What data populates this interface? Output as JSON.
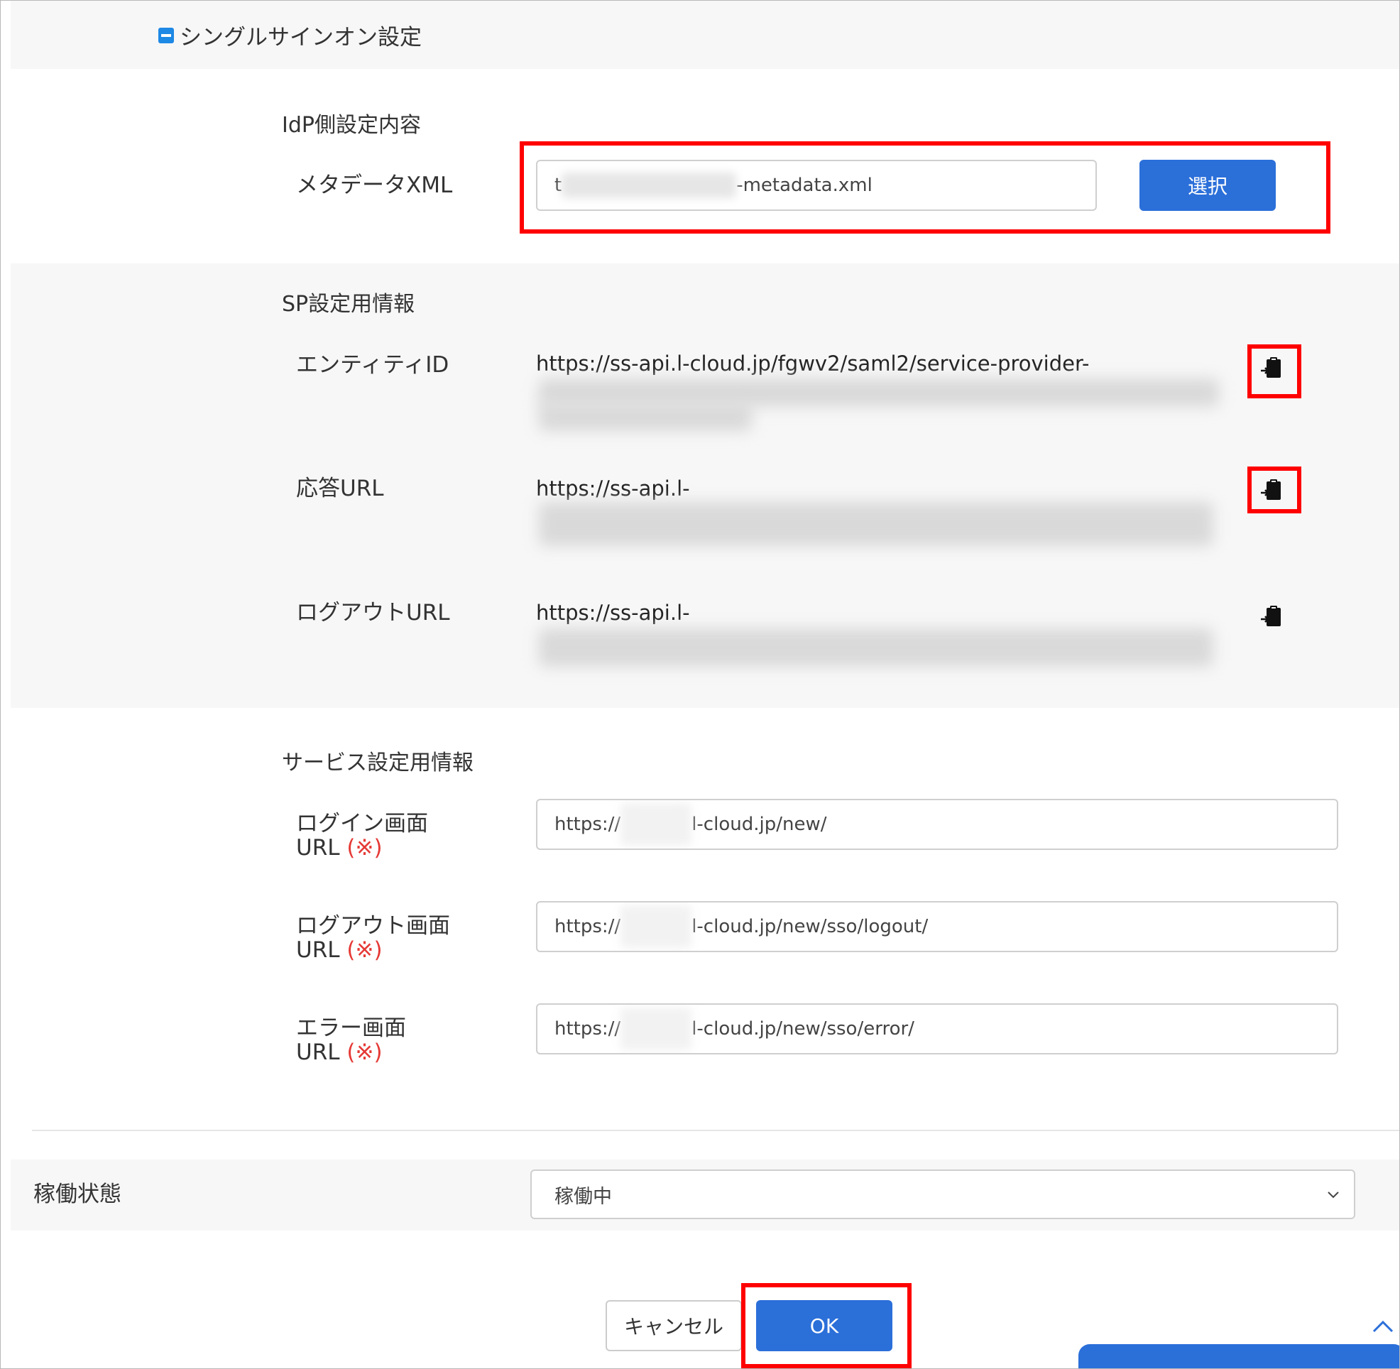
{
  "section": {
    "title": "シングルサインオン設定"
  },
  "idp": {
    "title": "IdP側設定内容",
    "metadata_label": "メタデータXML",
    "metadata_file_prefix": "t",
    "metadata_file_suffix": "-metadata.xml",
    "select_button": "選択"
  },
  "sp": {
    "title": "SP設定用情報",
    "entity_id_label": "エンティティID",
    "entity_id_value": "https://ss-api.l-cloud.jp/fgwv2/saml2/service-provider-",
    "reply_url_label": "応答URL",
    "reply_url_value": "https://ss-api.l-",
    "logout_url_label": "ログアウトURL",
    "logout_url_value": "https://ss-api.l-",
    "copy_icon": "clipboard-copy-icon"
  },
  "service": {
    "title": "サービス設定用情報",
    "login_label_line1": "ログイン画面",
    "logout_label_line1": "ログアウト画面",
    "error_label_line1": "エラー画面",
    "url_label": "URL",
    "required_mark": "(※)",
    "url_prefix": "https://",
    "login_url_suffix": "l-cloud.jp/new/",
    "logout_url_suffix": "l-cloud.jp/new/sso/logout/",
    "error_url_suffix": "l-cloud.jp/new/sso/error/"
  },
  "status": {
    "label": "稼働状態",
    "selected": "稼働中"
  },
  "footer": {
    "cancel": "キャンセル",
    "ok": "OK"
  },
  "colors": {
    "primary": "#2b6fd9",
    "highlight": "#ff0000",
    "required": "#e53935"
  }
}
